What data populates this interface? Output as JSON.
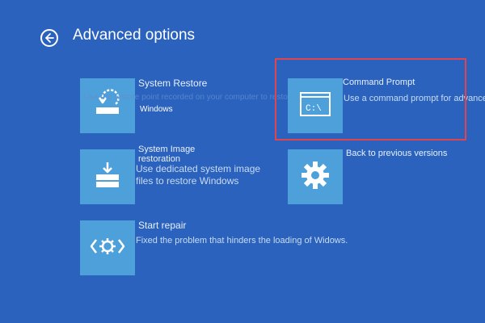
{
  "header": {
    "title": "Advanced options"
  },
  "options": {
    "system_restore": {
      "title": "System Restore",
      "desc_ghost": "Use the restore point recorded on your computer to restore",
      "desc_tail": "Windows"
    },
    "command_prompt": {
      "title": "Command Prompt",
      "desc": "Use a command prompt for advanced",
      "icon_text": "C:\\"
    },
    "system_image": {
      "title": "System Image restoration",
      "desc": "Use dedicated system image files to restore Windows"
    },
    "back_previous": {
      "title": "Back to previous versions"
    },
    "start_repair": {
      "title": "Start repair",
      "desc": "Fixed the problem that hinders the loading of Widows."
    }
  },
  "icons": {
    "back": "back-arrow-icon",
    "system_restore": "restore-icon",
    "command_prompt": "command-prompt-icon",
    "system_image": "system-image-icon",
    "back_previous": "gear-icon",
    "start_repair": "repair-icon"
  },
  "colors": {
    "background": "#2a62bd",
    "tile": "#4ea0da",
    "highlight": "#e0444e"
  }
}
